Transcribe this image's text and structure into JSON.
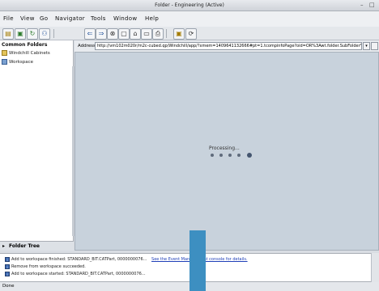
{
  "window": {
    "title": "Folder - Engineering (Active)",
    "controls": [
      "–",
      "□"
    ]
  },
  "menu": [
    "File",
    "View",
    "Go",
    "Navigator",
    "Tools",
    "Window",
    "Help"
  ],
  "toolbar": {
    "left_icons": [
      "folder-icon",
      "save-icon",
      "refresh-icon",
      "users-icon"
    ],
    "nav_icons": [
      "back-icon",
      "forward-icon",
      "stop-icon",
      "refresh-icon",
      "home-icon",
      "bookmark-icon",
      "print-icon"
    ],
    "right_icons": [
      "new-folder-icon",
      "search-icon"
    ]
  },
  "sidebar": {
    "header": "Common Folders",
    "items": [
      {
        "label": "Windchill Cabinets",
        "icon": "cabinet-icon"
      },
      {
        "label": "Workspace",
        "icon": "workspace-icon"
      }
    ],
    "folder_tree_label": "Folder Tree"
  },
  "address": {
    "label": "Address",
    "value": "http://vm102m020r/m2c-cubed.qp/Windchill/app/?xmem=1409641132666#pt=1.tcompinfoPage?oid=OR%3Awt.folder.SubFolder%3"
  },
  "main": {
    "processing_label": "Processing..."
  },
  "messages": [
    {
      "text": "Add to workspace finished: STANDARD_BIT.CATPart, 0000000076...",
      "link": "See the Event Management console for details."
    },
    {
      "text": "Remove from workspace succeeded.",
      "link": ""
    },
    {
      "text": "Add to workspace started: STANDARD_BIT.CATPart, 0000000076...",
      "link": ""
    }
  ],
  "status": {
    "text": "Done"
  }
}
